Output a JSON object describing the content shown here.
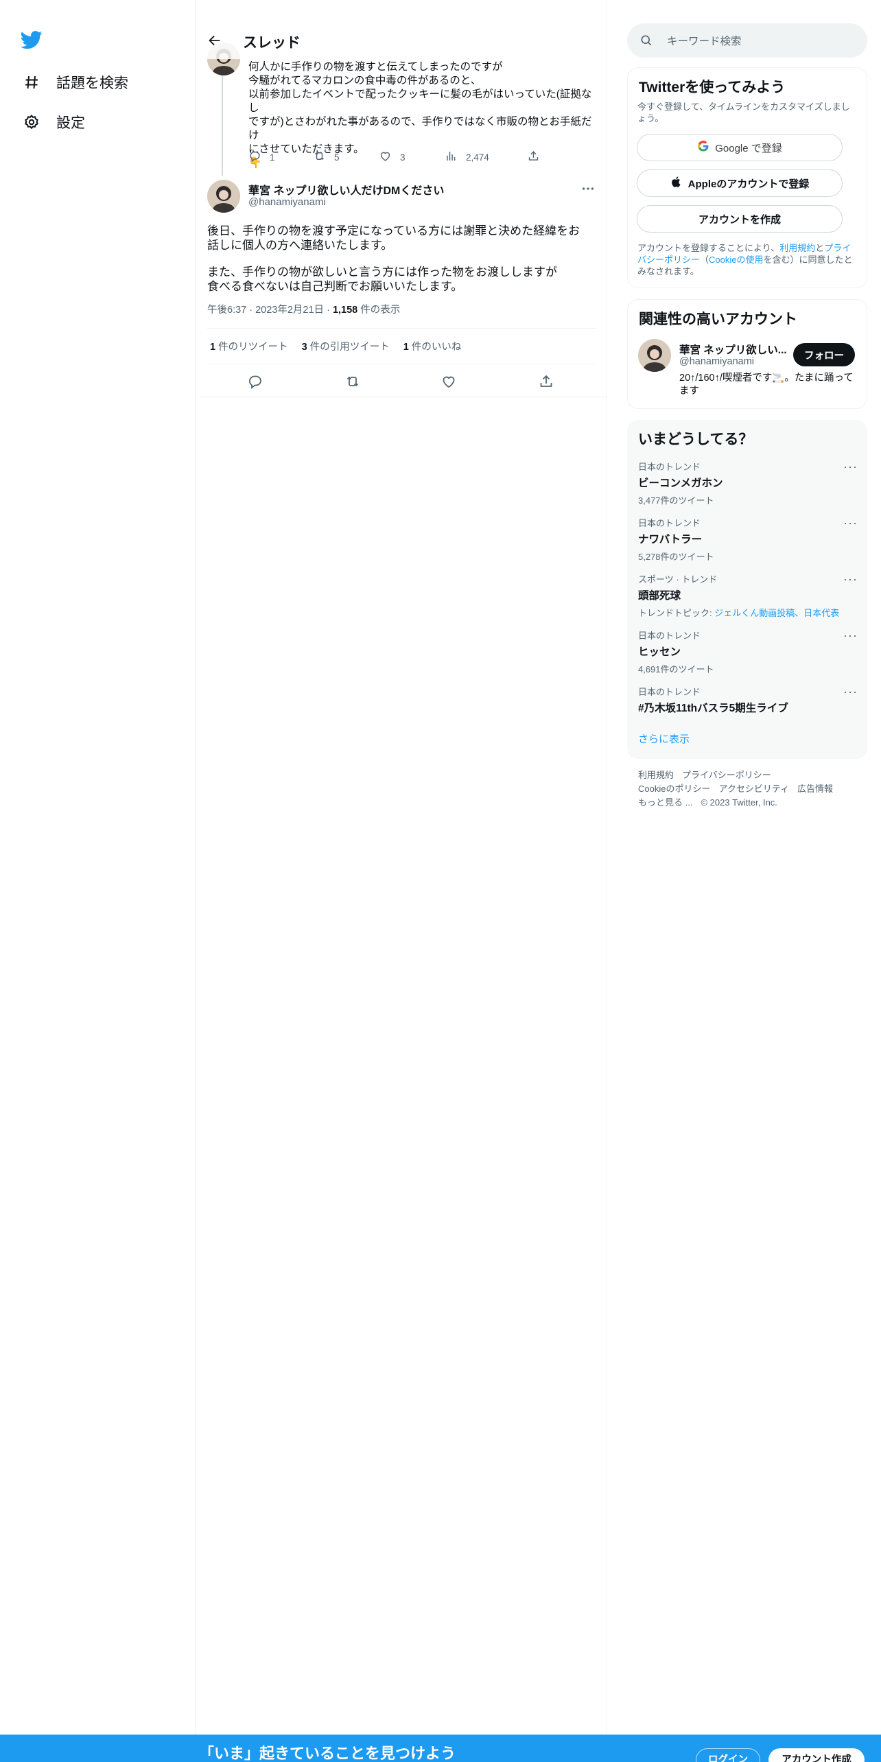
{
  "nav": {
    "explore_label": "話題を検索",
    "settings_label": "設定"
  },
  "header": {
    "title": "スレッド"
  },
  "prev_tweet": {
    "lines": [
      "何人かに手作りの物を渡すと伝えてしまったのですが",
      "今騒がれてるマカロンの食中毒の件があるのと、",
      "以前参加したイベントで配ったクッキーに髪の毛がはいっていた(証拠なし",
      "ですが)とさわがれた事があるので、手作りではなく市販の物とお手紙だけ",
      "にさせていただきます。"
    ],
    "emoji": "👇",
    "replies": "1",
    "retweets": "5",
    "likes": "3",
    "views": "2,474"
  },
  "main_tweet": {
    "display_name": "華宮 ネップリ欲しい人だけDMください",
    "handle": "@hanamiyanami",
    "para1_line1": "後日、手作りの物を渡す予定になっている方には謝罪と決めた経緯をお",
    "para1_line2": "話しに個人の方へ連絡いたします。",
    "para2_line1": "また、手作りの物が欲しいと言う方には作った物をお渡ししますが",
    "para2_line2": "食べる食べないは自己判断でお願いいたします。",
    "time": "午後6:37 · 2023年2月21日 · ",
    "views_count": "1,158",
    "views_label": " 件の表示",
    "retweets_count": "1",
    "retweets_label": " 件のリツイート",
    "quotes_count": "3",
    "quotes_label": " 件の引用ツイート",
    "likes_count": "1",
    "likes_label": " 件のいいね"
  },
  "search": {
    "placeholder": "キーワード検索"
  },
  "signup_card": {
    "title": "Twitterを使ってみよう",
    "subtitle": "今すぐ登録して、タイムラインをカスタマイズしましょう。",
    "google_label": "Google で登録",
    "apple_label": "Appleのアカウントで登録",
    "create_label": "アカウントを作成",
    "terms_prefix": "アカウントを登録することにより、",
    "terms_link": "利用規約",
    "terms_and": "と",
    "privacy_link": "プライバシーポリシー",
    "cookie_open": "（",
    "cookie_link": "Cookieの使用",
    "terms_suffix": "を含む）に同意したとみなされます。"
  },
  "related": {
    "title": "関連性の高いアカウント",
    "name": "華宮 ネップリ欲しい...",
    "handle": "@hanamiyanami",
    "bio": "20↑/160↑/喫煙者です🚬。たまに踊ってます",
    "follow_label": "フォロー"
  },
  "trends": {
    "title": "いまどうしてる？",
    "items": [
      {
        "context": "日本のトレンド",
        "name": "ビーコンメガホン",
        "count": "3,477件のツイート"
      },
      {
        "context": "日本のトレンド",
        "name": "ナワバトラー",
        "count": "5,278件のツイート"
      },
      {
        "context": "スポーツ · トレンド",
        "name": "頭部死球",
        "topic_prefix": "トレンドトピック: ",
        "topic_link": "ジェルくん動画投稿、日本代表"
      },
      {
        "context": "日本のトレンド",
        "name": "ヒッセン",
        "count": "4,691件のツイート"
      },
      {
        "context": "日本のトレンド",
        "name": "#乃木坂11thバスラ5期生ライブ"
      }
    ],
    "more_label": "さらに表示"
  },
  "footer": {
    "terms": "利用規約",
    "privacy": "プライバシーポリシー",
    "cookie": "Cookieのポリシー",
    "accessibility": "アクセシビリティ",
    "ads": "広告情報",
    "more": "もっと見る ...",
    "copyright": "© 2023 Twitter, Inc."
  },
  "bottom_bar": {
    "cta": "「いま」起きていることを見つけよう",
    "login": "ログイン",
    "signup": "アカウント作成"
  },
  "colors": {
    "accent": "#1d9bf0",
    "text": "#0f1419",
    "muted": "#536471"
  }
}
